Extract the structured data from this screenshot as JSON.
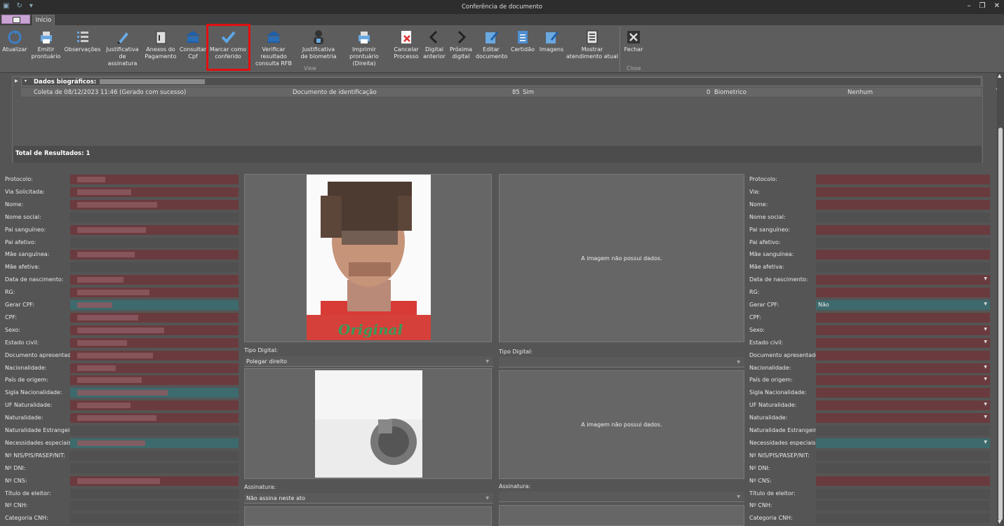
{
  "window": {
    "title": "Conferência de documento"
  },
  "tabs": {
    "home": "Início"
  },
  "ribbon": {
    "buttons": [
      {
        "name": "atualizar",
        "label": "Atualizar"
      },
      {
        "name": "emitir-prontuario",
        "label": "Emitir\nprontuário"
      },
      {
        "name": "observacoes",
        "label": "Observações"
      },
      {
        "name": "justificativa-assinatura",
        "label": "Justificativa\nde assinatura"
      },
      {
        "name": "anexos-pagamento",
        "label": "Anexos do\nPagamento"
      },
      {
        "name": "consultar-cpf",
        "label": "Consultar\nCpf"
      },
      {
        "name": "marcar-conferido",
        "label": "Marcar como\nconferido"
      },
      {
        "name": "verificar-rfb",
        "label": "Verificar resultado\nconsulta RFB"
      },
      {
        "name": "justificativa-biometria",
        "label": "Justificativa\nde biometria"
      },
      {
        "name": "imprimir-prontuario",
        "label": "Imprimir prontuário\n(Direita)"
      },
      {
        "name": "cancelar-processo",
        "label": "Cancelar\nProcesso"
      },
      {
        "name": "digital-anterior",
        "label": "Digital\nanterior"
      },
      {
        "name": "proxima-digital",
        "label": "Próxima\ndigital"
      },
      {
        "name": "editar-documento",
        "label": "Editar\ndocumento"
      },
      {
        "name": "certidao",
        "label": "Certidão"
      },
      {
        "name": "imagens",
        "label": "Imagens"
      },
      {
        "name": "mostrar-atendimento",
        "label": "Mostrar\natendimento atual"
      },
      {
        "name": "fechar",
        "label": "Fechar"
      }
    ],
    "group_view": "View",
    "group_close": "Close"
  },
  "grid": {
    "group_header": "Dados biográficos:",
    "row": {
      "coleta": "Coleta de 08/12/2023 11:46 (Gerado com sucesso)",
      "documento": "Documento de identificação",
      "score": "85",
      "sim": "Sim",
      "zero": "0",
      "tipo": "Biometrico",
      "nenhum": "Nenhum"
    },
    "total": "Total de Resultados: 1"
  },
  "left_form": {
    "labels": [
      "Protocolo:",
      "Via Solicitada:",
      "Nome:",
      "Nome social:",
      "Pai sanguíneo:",
      "Pai afetivo:",
      "Mãe sanguínea:",
      "Mãe afetiva:",
      "Data de nascimento:",
      "RG:",
      "Gerar CPF:",
      "CPF:",
      "Sexo:",
      "Estado civil:",
      "Documento apresentado:",
      "Nacionalidade:",
      "País de origem:",
      "Sigla Nacionalidade:",
      "UF Naturalidade:",
      "Naturalidade:",
      "Naturalidade Estrangeira:",
      "Necessidades especiais:",
      "Nº NIS/PIS/PASEP/NIT:",
      "Nº DNI:",
      "Nº CNS:",
      "Título de eleitor:",
      "Nº CNH:",
      "Categoria CNH:"
    ]
  },
  "right_form": {
    "labels": [
      "Protocolo:",
      "Via:",
      "Nome:",
      "Nome social:",
      "Pai sanguíneo:",
      "Pai afetivo:",
      "Mãe sanguínea:",
      "Mãe afetiva:",
      "Data de nascimento:",
      "RG:",
      "Gerar CPF:",
      "CPF:",
      "Sexo:",
      "Estado civil:",
      "Documento apresentado:",
      "Nacionalidade:",
      "País de origem:",
      "Sigla Nacionalidade:",
      "UF Naturalidade:",
      "Naturalidade:",
      "Naturalidade Estrangeira:",
      "Necessidades especiais:",
      "Nº NIS/PIS/PASEP/NIT:",
      "Nº DNI:",
      "Nº CNS:",
      "Título de eleitor:",
      "Nº CNH:",
      "Categoria CNH:"
    ],
    "gerar_cpf_value": "Não"
  },
  "center": {
    "photo_shirt_text": "Original",
    "no_data": "A imagem não possui dados.",
    "tipo_digital_label": "Tipo Digital:",
    "tipo_digital_value": "Polegar direito",
    "assinatura_label": "Assinatura:",
    "assinatura_value": "Não assina neste ato"
  }
}
